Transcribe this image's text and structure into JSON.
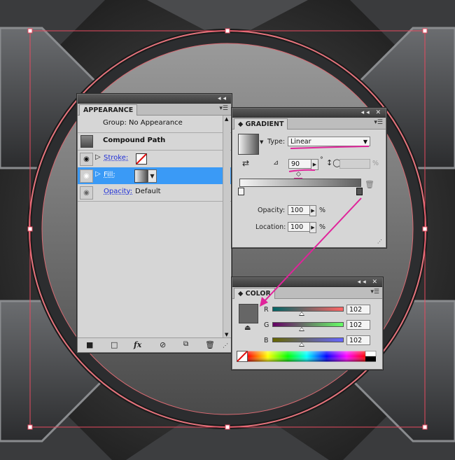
{
  "colors": {
    "selection_blue": "#3a9af6",
    "bounding_box": "#e84a5f",
    "annotation_magenta": "#e0249a",
    "swatch_gray": "#666666"
  },
  "appearance": {
    "tab": "APPEARANCE",
    "group_label": "Group: No Appearance",
    "compound_path": "Compound Path",
    "stroke_label": "Stroke:",
    "fill_label": "Fill:",
    "opacity_label": "Opacity:",
    "opacity_value": "Default",
    "bottom_icons": [
      "new-art-icon",
      "clear-appearance-icon",
      "fx-icon",
      "no-icon",
      "duplicate-icon",
      "trash-icon"
    ],
    "fx_label": "fx"
  },
  "gradient": {
    "tab": "GRADIENT",
    "type_label": "Type:",
    "type_value": "Linear",
    "angle_value": "90",
    "degree_symbol": "°",
    "aspect_unit": "%",
    "opacity_label": "Opacity:",
    "opacity_value": "100",
    "location_label": "Location:",
    "location_value": "100",
    "percent": "%"
  },
  "color": {
    "tab": "COLOR",
    "r_label": "R",
    "g_label": "G",
    "b_label": "B",
    "r_value": "102",
    "g_value": "102",
    "b_value": "102"
  }
}
